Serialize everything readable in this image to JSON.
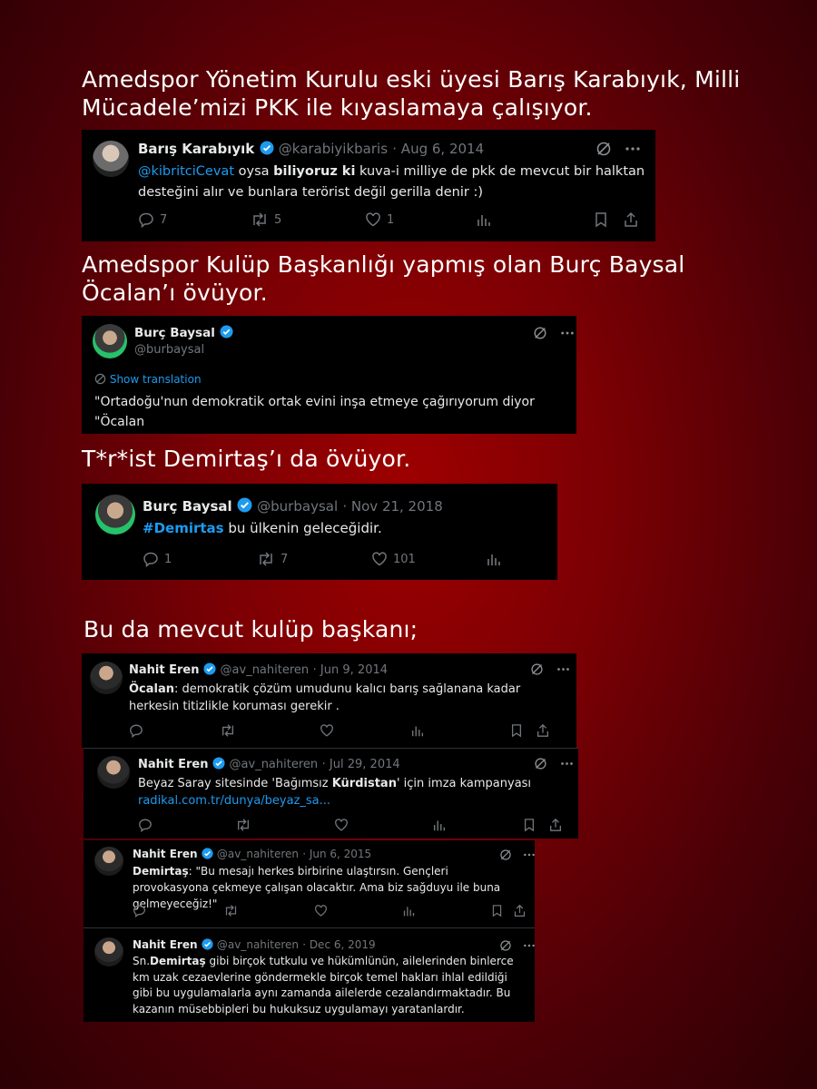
{
  "headings": [
    "Amedspor Yönetim Kurulu eski üyesi Barış Karabıyık, Milli Mücadele’mizi PKK ile kıyaslamaya çalışıyor.",
    "Amedspor Kulüp Başkanlığı yapmış olan Burç Baysal Öcalan’ı övüyor.",
    "T*r*ist Demirtaş’ı da övüyor.",
    "Bu da mevcut kulüp başkanı;"
  ],
  "tweet1": {
    "name": "Barış Karabıyık",
    "handle": "@karabiyikbaris",
    "date": "· Aug 6, 2014",
    "mention": "@kibritciCevat",
    "text_a": " oysa ",
    "bold": "biliyoruz ki",
    "text_b": " kuva-i milliye de pkk de mevcut bir halktan desteğini alır ve bunlara terörist değil gerilla denir :)",
    "replies": "7",
    "retweets": "5",
    "likes": "1"
  },
  "tweet2": {
    "name": "Burç Baysal",
    "handle": "@burbaysal",
    "translate": "Show translation",
    "text": "\"Ortadoğu'nun demokratik ortak evini inşa etmeye çağırıyorum diyor \"Öcalan"
  },
  "tweet3": {
    "name": "Burç Baysal",
    "handle": "@burbaysal",
    "date": "· Nov 21, 2018",
    "hashtag": "#Demirtas",
    "text": " bu ülkenin geleceğidir.",
    "replies": "1",
    "retweets": "7",
    "likes": "101"
  },
  "tweet4": {
    "name": "Nahit Eren",
    "handle": "@av_nahiteren",
    "date": "· Jun 9, 2014",
    "bold": "Öcalan",
    "text": ": demokratik çözüm umudunu kalıcı barış sağlanana kadar herkesin titizlikle koruması gerekir ."
  },
  "tweet5": {
    "name": "Nahit Eren",
    "handle": "@av_nahiteren",
    "date": "· Jul 29, 2014",
    "text_a": "Beyaz Saray sitesinde 'Bağımsız ",
    "bold": "Kürdistan",
    "text_b": "' için imza kampanyası",
    "link": "radikal.com.tr/dunya/beyaz_sa..."
  },
  "tweet6": {
    "name": "Nahit Eren",
    "handle": "@av_nahiteren",
    "date": "· Jun 6, 2015",
    "bold": "Demirtaş",
    "text": ": \"Bu mesajı herkes birbirine ulaştırsın. Gençleri provokasyona çekmeye çalışan olacaktır. Ama biz sağduyu ile buna gelmeyeceğiz!\""
  },
  "tweet7": {
    "name": "Nahit Eren",
    "handle": "@av_nahiteren",
    "date": "· Dec 6, 2019",
    "text_a": "Sn.",
    "bold": "Demirtaş",
    "text_b": " gibi birçok tutkulu ve hükümlünün, ailelerinden binlerce km uzak cezaevlerine göndermekle birçok temel hakları ihlal edildiği gibi bu uygulamalarla aynı zamanda ailelerde cezalandırmaktadır. Bu kazanın müsebbipleri bu hukuksuz uygulamayı yaratanlardır."
  },
  "colors": {
    "background": "#8b0000",
    "tweet_bg": "#000000",
    "link": "#1d9bf0",
    "verified": "#1d9bf0",
    "muted": "#71767b"
  },
  "icons": [
    "verified-badge-icon",
    "grok-icon",
    "more-icon",
    "reply-icon",
    "retweet-icon",
    "like-icon",
    "views-icon",
    "bookmark-icon",
    "share-icon",
    "translate-icon"
  ]
}
